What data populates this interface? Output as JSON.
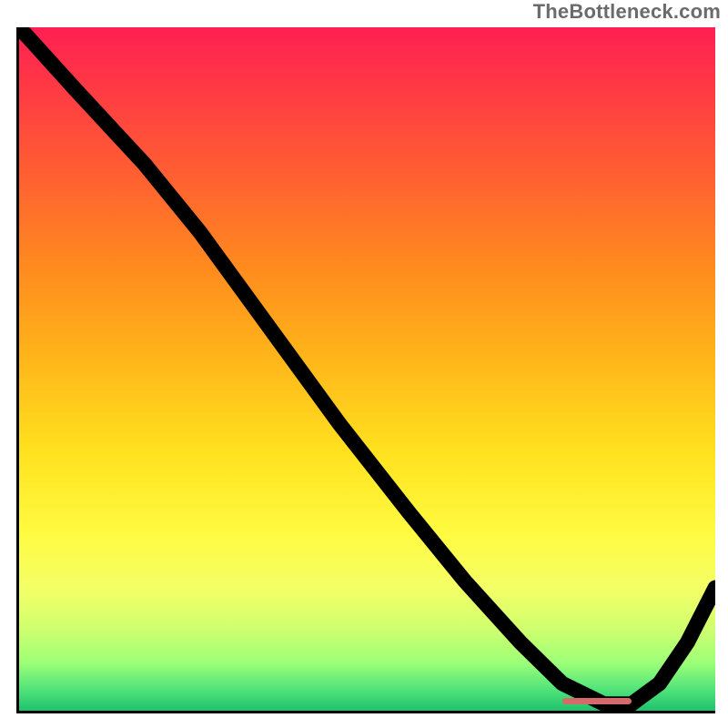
{
  "watermark": "TheBottleneck.com",
  "chart_data": {
    "type": "line",
    "title": "",
    "xlabel": "",
    "ylabel": "",
    "xlim": [
      0,
      100
    ],
    "ylim": [
      0,
      100
    ],
    "grid": false,
    "legend": false,
    "background": "heat_gradient_red_to_green",
    "series": [
      {
        "name": "bottleneck-curve",
        "x": [
          0,
          8,
          18,
          26,
          36,
          46,
          56,
          64,
          72,
          78,
          84,
          88,
          92,
          96,
          100
        ],
        "values": [
          100,
          91,
          80,
          70,
          56,
          42,
          29,
          19,
          10,
          4,
          1,
          1,
          4,
          10,
          18
        ]
      }
    ],
    "annotations": [
      {
        "name": "optimum-flat-marker",
        "x_start": 78,
        "x_end": 88,
        "y": 1.5
      }
    ],
    "gradient_stops": [
      {
        "pos": 0.0,
        "color": "#ff1f52"
      },
      {
        "pos": 0.08,
        "color": "#ff3745"
      },
      {
        "pos": 0.2,
        "color": "#ff5a34"
      },
      {
        "pos": 0.35,
        "color": "#ff8a1e"
      },
      {
        "pos": 0.48,
        "color": "#ffb41a"
      },
      {
        "pos": 0.62,
        "color": "#ffe11e"
      },
      {
        "pos": 0.74,
        "color": "#fffb40"
      },
      {
        "pos": 0.82,
        "color": "#f4ff66"
      },
      {
        "pos": 0.88,
        "color": "#d0ff6e"
      },
      {
        "pos": 0.93,
        "color": "#9cff78"
      },
      {
        "pos": 0.97,
        "color": "#4fe27a"
      },
      {
        "pos": 1.0,
        "color": "#1fc26e"
      }
    ]
  }
}
